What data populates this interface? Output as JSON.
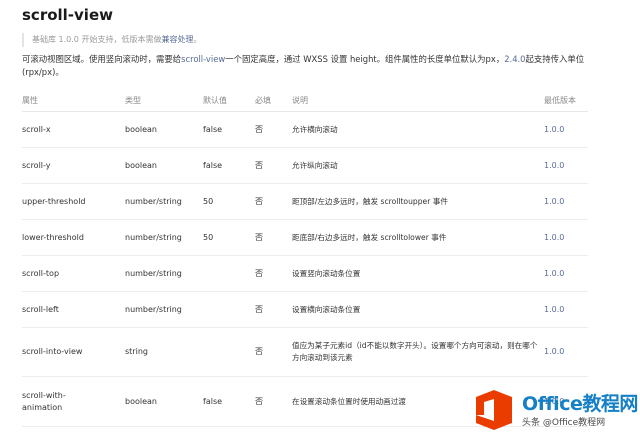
{
  "page": {
    "title": "scroll-view",
    "notice": {
      "text": "基础库 1.0.0 开始支持，低版本需做",
      "link": "兼容处理",
      "suffix": "。"
    },
    "description": {
      "part1": "可滚动视图区域。使用竖向滚动时，需要给",
      "link": "scroll-view",
      "part2": "一个固定高度，通过 WXSS 设置 height。组件属性的长度单位默认为px，",
      "version": "2.4.0",
      "part3": "起支持传入单位(rpx/px)。"
    }
  },
  "table": {
    "headers": [
      "属性",
      "类型",
      "默认值",
      "必填",
      "说明",
      "最低版本"
    ],
    "rows": [
      {
        "attr": "scroll-x",
        "type": "boolean",
        "default": "false",
        "required": "否",
        "desc": "允许横向滚动",
        "version": "1.0.0"
      },
      {
        "attr": "scroll-y",
        "type": "boolean",
        "default": "false",
        "required": "否",
        "desc": "允许纵向滚动",
        "version": "1.0.0"
      },
      {
        "attr": "upper-threshold",
        "type": "number/string",
        "default": "50",
        "required": "否",
        "desc": "距顶部/左边多远时，触发 scrolltoupper 事件",
        "version": "1.0.0"
      },
      {
        "attr": "lower-threshold",
        "type": "number/string",
        "default": "50",
        "required": "否",
        "desc": "距底部/右边多远时，触发 scrolltolower 事件",
        "version": "1.0.0"
      },
      {
        "attr": "scroll-top",
        "type": "number/string",
        "default": "",
        "required": "否",
        "desc": "设置竖向滚动条位置",
        "version": "1.0.0"
      },
      {
        "attr": "scroll-left",
        "type": "number/string",
        "default": "",
        "required": "否",
        "desc": "设置横向滚动条位置",
        "version": "1.0.0"
      },
      {
        "attr": "scroll-into-view",
        "type": "string",
        "default": "",
        "required": "否",
        "desc": "值应为某子元素id（id不能以数字开头）。设置哪个方向可滚动，则在哪个方向滚动到该元素",
        "version": "1.0.0"
      },
      {
        "attr": "scroll-with-animation",
        "type": "boolean",
        "default": "false",
        "required": "否",
        "desc": "在设置滚动条位置时使用动画过渡",
        "version": "1.0.0"
      }
    ]
  },
  "watermark": {
    "brand": "Office教程网",
    "sub": "头条 @Office教程网",
    "icon": "office-logo-icon",
    "colors": {
      "orange": "#eb3c00",
      "blue": "#1580c6"
    }
  },
  "colors": {
    "link": "#576b95",
    "text": "#333333",
    "muted": "#888888",
    "border": "#ececec"
  }
}
